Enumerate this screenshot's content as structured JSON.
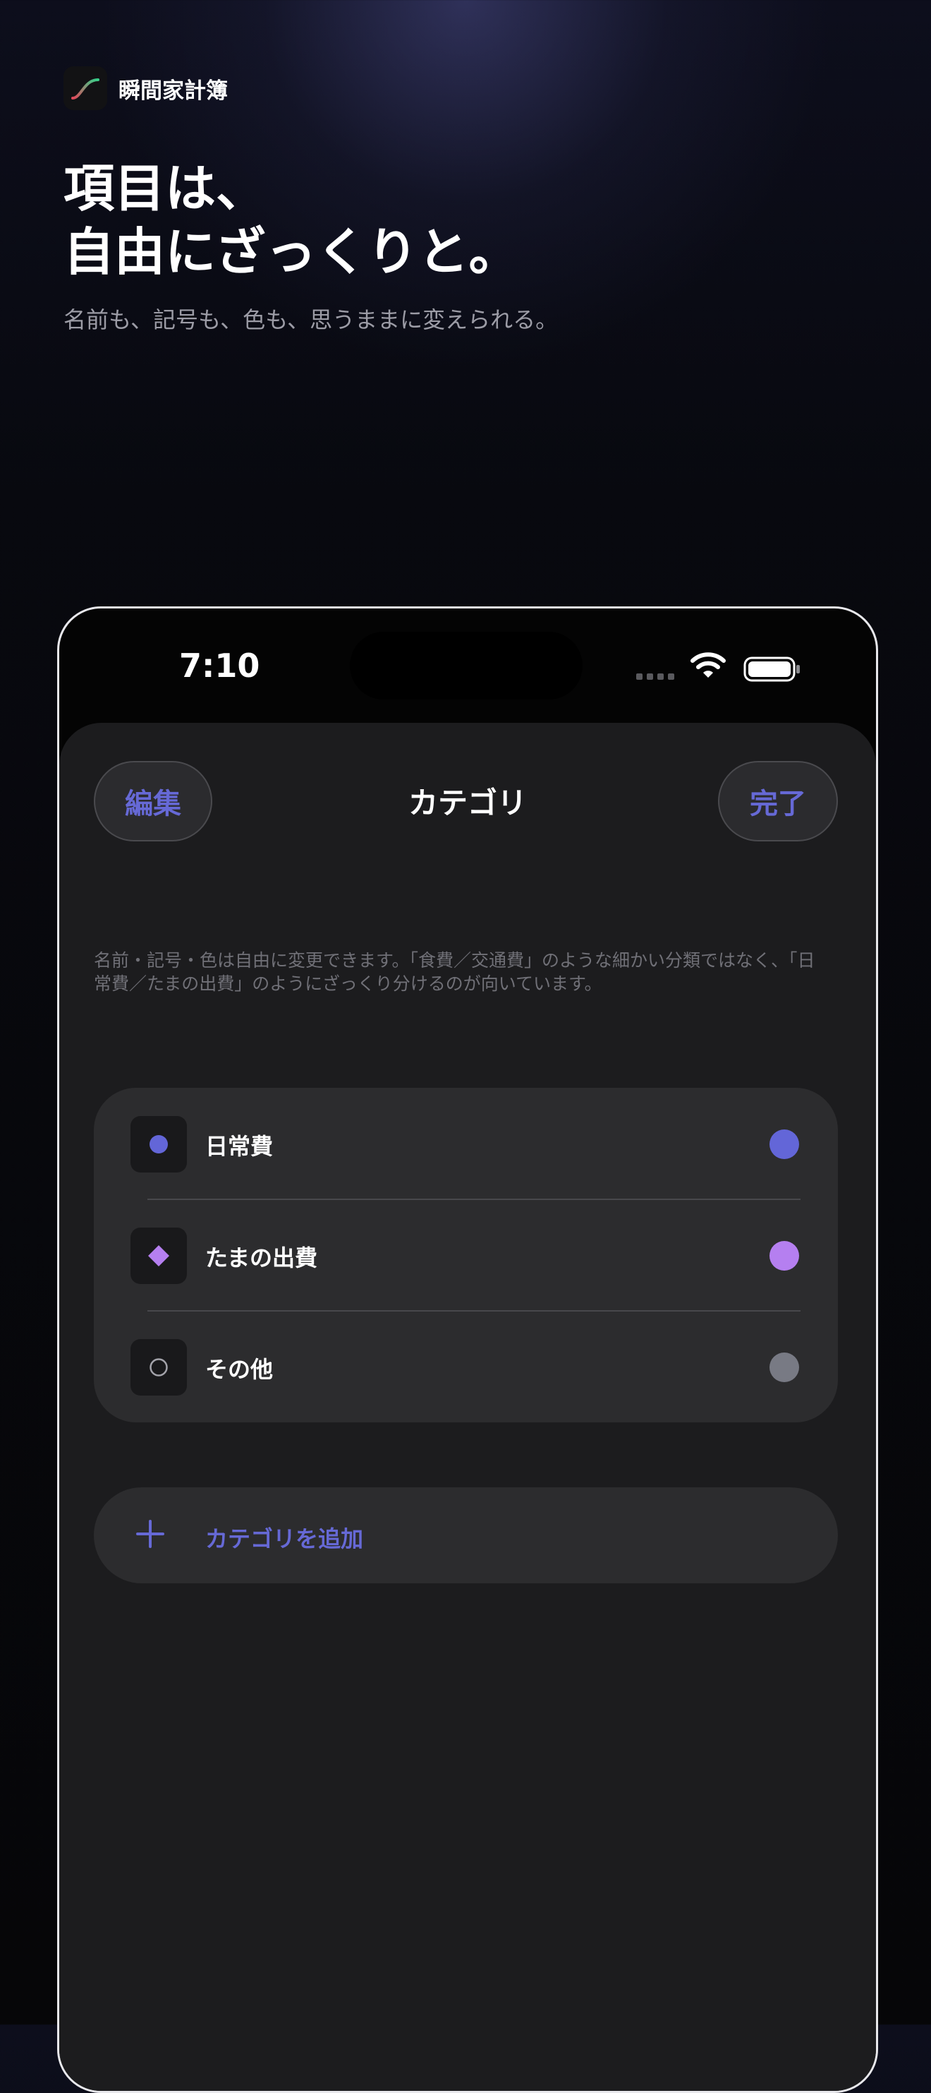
{
  "brand": {
    "name": "瞬間家計簿",
    "icon": "trend-curve-icon"
  },
  "headline": {
    "line1": "項目は、",
    "line2": "自由にざっくりと。"
  },
  "subhead": "名前も、記号も、色も、思うままに変えられる。",
  "status_bar": {
    "time": "7:10",
    "icons": [
      "cellular-signal-icon",
      "wifi-icon",
      "battery-icon"
    ]
  },
  "nav": {
    "edit_label": "編集",
    "title": "カテゴリ",
    "done_label": "完了"
  },
  "description": "名前・記号・色は自由に変更できます。「食費／交通費」のような細かい分類ではなく、「日常費／たまの出費」のようにざっくり分けるのが向いています。",
  "categories": [
    {
      "label": "日常費",
      "symbol": "filled-circle-icon",
      "color": "#6366d8"
    },
    {
      "label": "たまの出費",
      "symbol": "diamond-icon",
      "color": "#b57ff0"
    },
    {
      "label": "その他",
      "symbol": "hollow-circle-icon",
      "color": "#787a84"
    }
  ],
  "add_category": {
    "label": "カテゴリを追加",
    "icon": "plus-icon"
  },
  "colors": {
    "accent": "#6669d6",
    "sheet": "#1c1c1e",
    "card": "#2c2c2e"
  }
}
